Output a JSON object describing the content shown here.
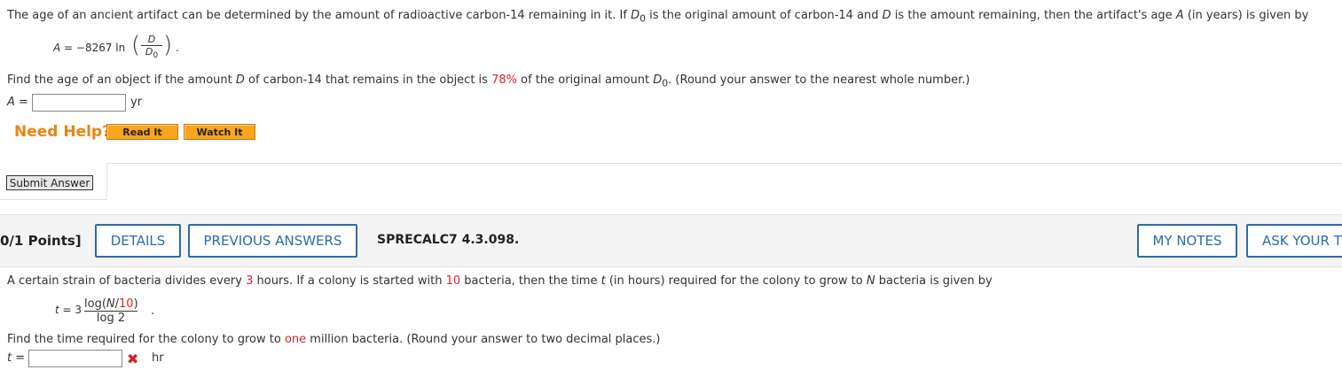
{
  "problem1": {
    "intro": "The age of an ancient artifact can be determined by the amount of radioactive carbon-14 remaining in it. If",
    "intro_var1": "D",
    "intro_sub1": "0",
    "intro_mid": " is the original amount of carbon-14 and ",
    "intro_var2": "D",
    "intro_mid2": " is the amount remaining, then the artifact's age ",
    "intro_var3": "A",
    "intro_end": " (in years) is given by",
    "formula_left": "A",
    "formula_eq": " = −8267 ln",
    "formula_num": "D",
    "formula_den": "D",
    "formula_den_sub": "0",
    "formula_dot": ".",
    "question_a": "Find the age of an object if the amount ",
    "question_var": "D",
    "question_b": " of carbon-14 that remains in the object is ",
    "question_percent": "78%",
    "question_c": " of the original amount ",
    "question_var2": "D",
    "question_sub2": "0",
    "question_d": ". (Round your answer to the nearest whole number.)",
    "answer_label": "A =",
    "answer_value": "",
    "answer_unit": "yr",
    "need_help": "Need Help?",
    "read_it": "Read It",
    "watch_it": "Watch It",
    "submit": "Submit Answer"
  },
  "header": {
    "points": "0/1 Points]",
    "details": "DETAILS",
    "previous_answers": "PREVIOUS ANSWERS",
    "problem_code": "SPRECALC7 4.3.098.",
    "my_notes": "MY NOTES",
    "ask_your_teacher": "ASK YOUR T"
  },
  "problem2": {
    "intro_a": "A certain strain of bacteria divides every ",
    "hours": "3",
    "intro_b": " hours. If a colony is started with ",
    "start_count": "10",
    "intro_c": " bacteria, then the time ",
    "var_t": "t",
    "intro_d": " (in hours) required for the colony to grow to ",
    "var_n": "N",
    "intro_e": " bacteria is given by",
    "formula_left": "t = ",
    "formula_coef": "3",
    "formula_num_a": "log(",
    "formula_num_var": "N",
    "formula_num_b": "/",
    "formula_num_red": "10",
    "formula_num_c": ")",
    "formula_den": "log 2",
    "formula_dot": ".",
    "question_a": "Find the time required for the colony to grow to ",
    "question_red": "one",
    "question_b": " million bacteria. (Round your answer to two decimal places.)",
    "answer_label": "t =",
    "answer_value": "",
    "answer_status": "✖",
    "answer_unit": "hr"
  },
  "colors": {
    "highlight_red": "#e0242e",
    "accent_blue": "#2b6cb0",
    "help_orange": "#e8850f",
    "button_orange": "#f8a51c"
  }
}
